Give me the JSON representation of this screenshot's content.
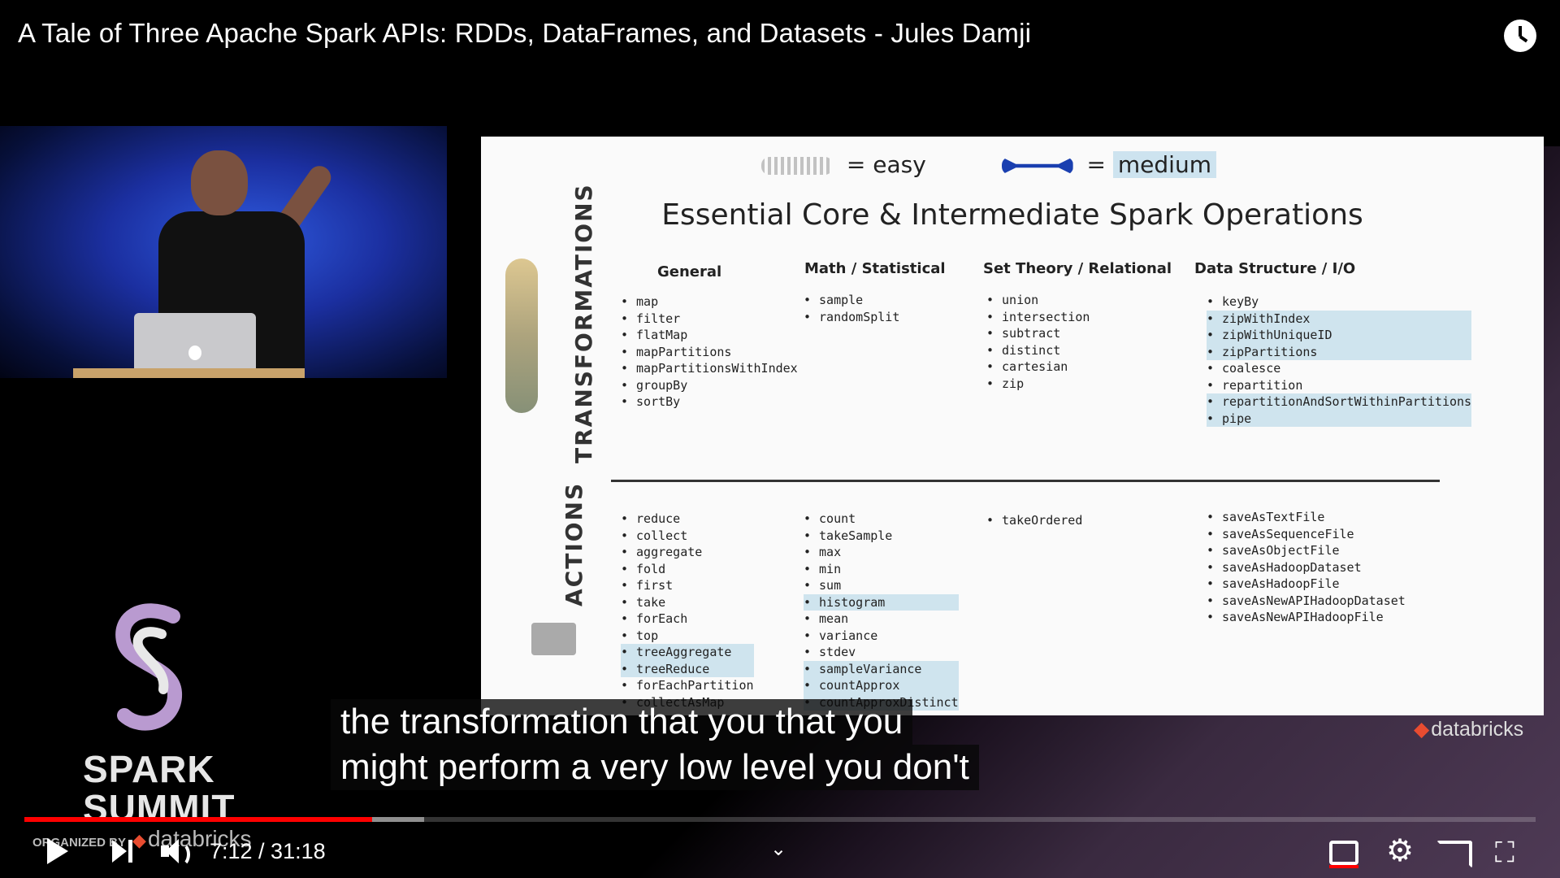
{
  "video": {
    "title": "A Tale of Three Apache Spark APIs: RDDs, DataFrames, and Datasets - Jules Damji",
    "caption_line1": "the transformation that you that you",
    "caption_line2": "might perform a very low level you don't",
    "time_display": "7:12 / 31:18",
    "progress_fraction": 0.2299,
    "buffered_fraction": 0.2645
  },
  "slide": {
    "legend_easy": "= easy",
    "legend_medium_eq": "=",
    "legend_medium": "medium",
    "title": "Essential Core & Intermediate Spark Operations",
    "section_transformations": "TRANSFORMATIONS",
    "section_actions": "ACTIONS",
    "columns": {
      "general": "General",
      "math": "Math / Statistical",
      "set": "Set Theory / Relational",
      "data": "Data Structure / I/O"
    },
    "transformations": {
      "general": [
        "map",
        "filter",
        "flatMap",
        "mapPartitions",
        "mapPartitionsWithIndex",
        "groupBy",
        "sortBy"
      ],
      "math": [
        "sample",
        "randomSplit"
      ],
      "set": [
        "union",
        "intersection",
        "subtract",
        "distinct",
        "cartesian",
        "zip"
      ],
      "data": [
        "keyBy",
        "zipWithIndex",
        "zipWithUniqueID",
        "zipPartitions",
        "coalesce",
        "repartition",
        "repartitionAndSortWithinPartitions",
        "pipe"
      ]
    },
    "actions": {
      "general": [
        "reduce",
        "collect",
        "aggregate",
        "fold",
        "first",
        "take",
        "forEach",
        "top",
        "treeAggregate",
        "treeReduce",
        "forEachPartition",
        "collectAsMap"
      ],
      "math": [
        "count",
        "takeSample",
        "max",
        "min",
        "sum",
        "histogram",
        "mean",
        "variance",
        "stdev",
        "sampleVariance",
        "countApprox",
        "countApproxDistinct"
      ],
      "set": [
        "takeOrdered"
      ],
      "data": [
        "saveAsTextFile",
        "saveAsSequenceFile",
        "saveAsObjectFile",
        "saveAsHadoopDataset",
        "saveAsHadoopFile",
        "saveAsNewAPIHadoopDataset",
        "saveAsNewAPIHadoopFile"
      ]
    },
    "highlighted": [
      "zipWithIndex",
      "zipWithUniqueID",
      "zipPartitions",
      "repartitionAndSortWithinPartitions",
      "pipe",
      "treeAggregate",
      "treeReduce",
      "histogram",
      "sampleVariance",
      "countApprox",
      "countApproxDistinct"
    ],
    "footer_brand": "databricks"
  },
  "branding": {
    "event_line1": "SPARK",
    "event_line2": "SUMMIT",
    "organized_by": "ORGANIZED BY",
    "organizer": "databricks"
  },
  "icons": {
    "watch_later": "clock-icon",
    "play": "play-icon",
    "next": "next-icon",
    "volume": "volume-icon",
    "expand": "chevron-down-icon",
    "subtitles": "subtitles-icon",
    "settings": "gear-icon",
    "cast": "cast-icon",
    "exit_fullscreen": "exit-fullscreen-icon"
  },
  "colors": {
    "progress_played": "#ff0000",
    "highlight": "#cfe4ee",
    "brand_red": "#e84c30"
  }
}
